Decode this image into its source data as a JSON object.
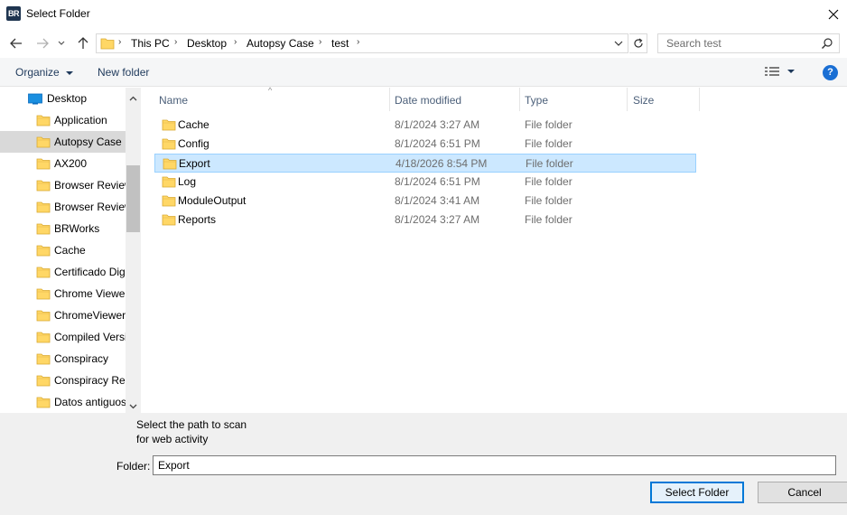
{
  "window": {
    "app_icon_text": "BR",
    "title": "Select Folder"
  },
  "nav": {
    "breadcrumbs": [
      "This PC",
      "Desktop",
      "Autopsy Case",
      "test"
    ],
    "search_placeholder": "Search test"
  },
  "toolbar": {
    "organize_label": "Organize",
    "new_folder_label": "New folder",
    "help_label": "?"
  },
  "tree": {
    "root_label": "Desktop",
    "items": [
      {
        "label": "Application",
        "selected": false
      },
      {
        "label": "Autopsy Case",
        "selected": true
      },
      {
        "label": "AX200",
        "selected": false
      },
      {
        "label": "Browser Review",
        "selected": false
      },
      {
        "label": "Browser Review",
        "selected": false
      },
      {
        "label": "BRWorks",
        "selected": false
      },
      {
        "label": "Cache",
        "selected": false
      },
      {
        "label": "Certificado Digi",
        "selected": false
      },
      {
        "label": "Chrome Viewer",
        "selected": false
      },
      {
        "label": "ChromeViewer",
        "selected": false
      },
      {
        "label": "Compiled Versi",
        "selected": false
      },
      {
        "label": "Conspiracy",
        "selected": false
      },
      {
        "label": "Conspiracy Reg",
        "selected": false
      },
      {
        "label": "Datos antiguos",
        "selected": false
      }
    ]
  },
  "filelist": {
    "columns": [
      "Name",
      "Date modified",
      "Type",
      "Size"
    ],
    "rows": [
      {
        "name": "Cache",
        "date": "8/1/2024 3:27 AM",
        "type": "File folder",
        "selected": false
      },
      {
        "name": "Config",
        "date": "8/1/2024 6:51 PM",
        "type": "File folder",
        "selected": false
      },
      {
        "name": "Export",
        "date": "4/18/2026 8:54 PM",
        "type": "File folder",
        "selected": true
      },
      {
        "name": "Log",
        "date": "8/1/2024 6:51 PM",
        "type": "File folder",
        "selected": false
      },
      {
        "name": "ModuleOutput",
        "date": "8/1/2024 3:41 AM",
        "type": "File folder",
        "selected": false
      },
      {
        "name": "Reports",
        "date": "8/1/2024 3:27 AM",
        "type": "File folder",
        "selected": false
      }
    ]
  },
  "footer": {
    "hint_line1": "Select the path to scan",
    "hint_line2": "for web activity",
    "folder_label": "Folder:",
    "folder_value": "Export",
    "select_button": "Select Folder",
    "cancel_button": "Cancel"
  },
  "colors": {
    "accent": "#0078d7",
    "selection_bg": "#cce8ff",
    "folder_yellow": "#ffd766"
  }
}
